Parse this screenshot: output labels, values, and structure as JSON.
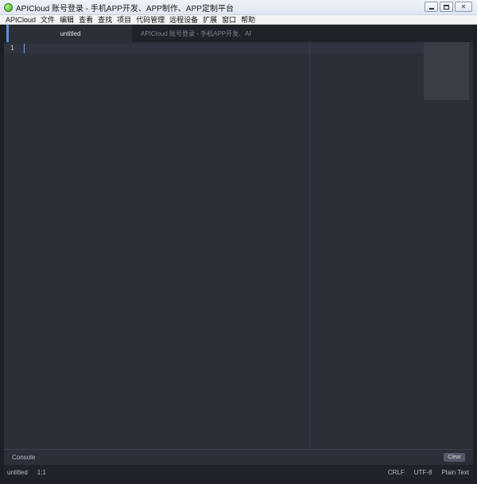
{
  "window": {
    "title": "APICloud 账号登录 - 手机APP开发、APP制作、APP定制平台",
    "controls": {
      "minimize": "",
      "maximize": "",
      "close": "✕"
    }
  },
  "menu": [
    {
      "label": "APICloud"
    },
    {
      "label": "文件"
    },
    {
      "label": "编辑"
    },
    {
      "label": "查看"
    },
    {
      "label": "查找"
    },
    {
      "label": "项目"
    },
    {
      "label": "代码管理"
    },
    {
      "label": "远程设备"
    },
    {
      "label": "扩展"
    },
    {
      "label": "窗口"
    },
    {
      "label": "帮助"
    }
  ],
  "tabs": [
    {
      "label": "untitled",
      "active": true
    },
    {
      "label": "APICloud 账号登录 - 手机APP开发、APP",
      "active": false,
      "icon": "cloud-icon"
    }
  ],
  "editor": {
    "line_numbers": [
      "1"
    ]
  },
  "console": {
    "label": "Console",
    "clear_label": "Clear"
  },
  "status": {
    "file": "untitled",
    "position": "1:1",
    "line_ending": "CRLF",
    "encoding": "UTF-8",
    "syntax": "Plain Text"
  },
  "colors": {
    "editor_bg": "#2b2f38",
    "accent": "#5b8ed6",
    "app_icon": "#3fa91f"
  }
}
